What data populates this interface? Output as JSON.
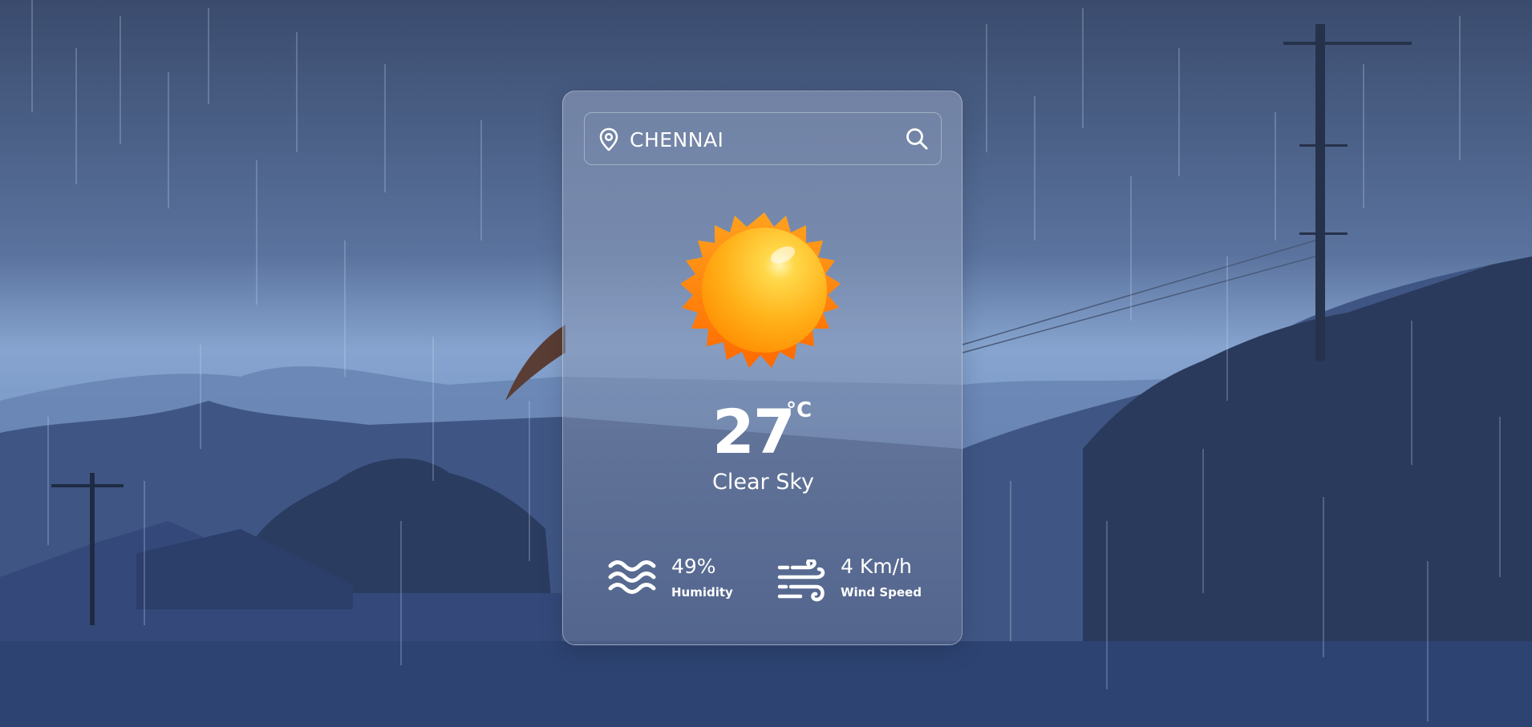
{
  "search": {
    "value": "CHENNAI"
  },
  "weather": {
    "icon": "sun-icon",
    "temperature": "27",
    "unit": "°C",
    "description": "Clear Sky"
  },
  "details": {
    "humidity": {
      "icon": "humidity-waves-icon",
      "value": "49%",
      "label": "Humidity"
    },
    "wind": {
      "icon": "wind-icon",
      "value": "4 Km/h",
      "label": "Wind Speed"
    }
  },
  "colors": {
    "text": "#ffffff",
    "sun_core": "#ffb21a",
    "sun_rays": "#ff7a00"
  }
}
